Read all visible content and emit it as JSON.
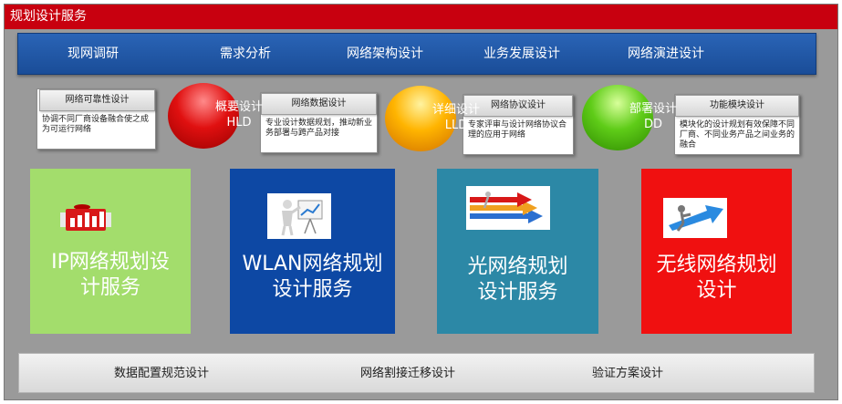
{
  "header": {
    "title": "规划设计服务"
  },
  "phases": [
    "现网调研",
    "需求分析",
    "网络架构设计",
    "业务发展设计",
    "网络演进设计"
  ],
  "cards": [
    {
      "title": "网络可靠性设计",
      "desc": "协调不同厂商设备融合使之成为可运行网络"
    },
    {
      "title": "网络数据设计",
      "desc": "专业设计数据规划，推动新业务部署与跨产品对接"
    },
    {
      "title": "网络协议设计",
      "desc": "专家评审与设计网络协议合理的应用于网络"
    },
    {
      "title": "功能模块设计",
      "desc": "模块化的设计规划有效保障不同厂商、不同业务产品之间业务的融合"
    }
  ],
  "orbs": [
    {
      "line1": "概要设计",
      "line2": "HLD"
    },
    {
      "line1": "详细设计",
      "line2": "LLD"
    },
    {
      "line1": "部署设计",
      "line2": "DD"
    }
  ],
  "services": [
    {
      "line1": "IP网络规划设",
      "line2": "计服务",
      "color": "#a3dd6c"
    },
    {
      "line1": "WLAN网络规划",
      "line2": "设计服务",
      "color": "#0d48a4"
    },
    {
      "line1": "光网络规划",
      "line2": "设计服务",
      "color": "#2c88a6"
    },
    {
      "line1": "无线网络规划",
      "line2": "设计",
      "color": "#f01010"
    }
  ],
  "bottom": [
    "数据配置规范设计",
    "网络割接迁移设计",
    "验证方案设计"
  ]
}
